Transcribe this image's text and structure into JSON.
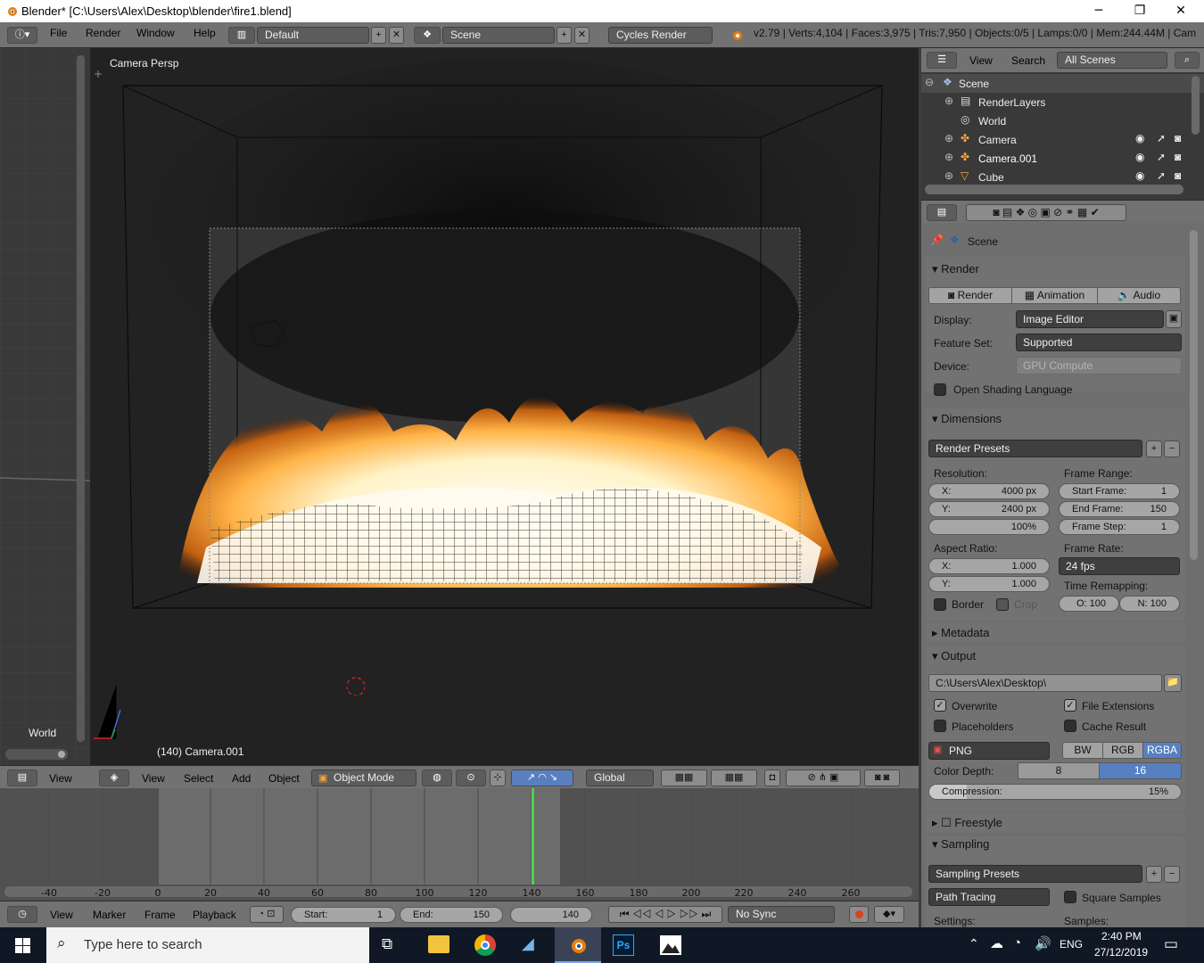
{
  "window": {
    "title": "Blender* [C:\\Users\\Alex\\Desktop\\blender\\fire1.blend]",
    "minimize": "─",
    "maximize": "❐",
    "close": "✕"
  },
  "menubar": {
    "items": [
      "File",
      "Render",
      "Window",
      "Help"
    ],
    "layout": "Default",
    "scene": "Scene",
    "engine": "Cycles Render",
    "stats": "v2.79 | Verts:4,104 | Faces:3,975 | Tris:7,950 | Objects:0/5 | Lamps:0/0 | Mem:244.44M | Cam"
  },
  "viewport": {
    "label": "Camera Persp",
    "status": "(140) Camera.001",
    "world_label": "World"
  },
  "view3d_header": {
    "items": [
      "View",
      "Select",
      "Add",
      "Object"
    ],
    "mode": "Object Mode",
    "orientation": "Global"
  },
  "left_header": {
    "view": "View"
  },
  "timeline": {
    "ticks": [
      "-40",
      "-20",
      "0",
      "20",
      "40",
      "60",
      "80",
      "100",
      "120",
      "140",
      "160",
      "180",
      "200",
      "220",
      "240",
      "260"
    ],
    "current": 140,
    "menu": [
      "View",
      "Marker",
      "Frame",
      "Playback"
    ],
    "start_label": "Start:",
    "start": "1",
    "end_label": "End:",
    "end": "150",
    "frame": "140",
    "sync": "No Sync"
  },
  "outliner": {
    "view": "View",
    "search": "Search",
    "filter": "All Scenes",
    "rows": [
      {
        "name": "Scene"
      },
      {
        "name": "RenderLayers"
      },
      {
        "name": "World"
      },
      {
        "name": "Camera"
      },
      {
        "name": "Camera.001"
      },
      {
        "name": "Cube"
      }
    ]
  },
  "properties": {
    "context": "Scene",
    "render": {
      "title": "Render",
      "buttons": [
        "Render",
        "Animation",
        "Audio"
      ],
      "display_label": "Display:",
      "display": "Image Editor",
      "feature_label": "Feature Set:",
      "feature": "Supported",
      "device_label": "Device:",
      "device": "GPU Compute",
      "osl": "Open Shading Language"
    },
    "dimensions": {
      "title": "Dimensions",
      "presets": "Render Presets",
      "res_label": "Resolution:",
      "x_label": "X:",
      "x": "4000 px",
      "y_label": "Y:",
      "y": "2400 px",
      "pct": "100%",
      "range_label": "Frame Range:",
      "start_label": "Start Frame:",
      "start": "1",
      "end_label": "End Frame:",
      "end": "150",
      "step_label": "Frame Step:",
      "step": "1",
      "aspect_label": "Aspect Ratio:",
      "ax_label": "X:",
      "ax": "1.000",
      "ay_label": "Y:",
      "ay": "1.000",
      "rate_label": "Frame Rate:",
      "rate": "24 fps",
      "remap_label": "Time Remapping:",
      "old": "O: 100",
      "new": "N: 100",
      "border": "Border",
      "crop": "Crop"
    },
    "metadata": {
      "title": "Metadata"
    },
    "output": {
      "title": "Output",
      "path": "C:\\Users\\Alex\\Desktop\\",
      "overwrite": "Overwrite",
      "file_ext": "File Extensions",
      "placeholders": "Placeholders",
      "cache": "Cache Result",
      "format": "PNG",
      "modes": [
        "BW",
        "RGB",
        "RGBA"
      ],
      "depth_label": "Color Depth:",
      "depths": [
        "8",
        "16"
      ],
      "compression_label": "Compression:",
      "compression": "15%"
    },
    "freestyle": {
      "title": "Freestyle"
    },
    "sampling": {
      "title": "Sampling",
      "presets": "Sampling Presets",
      "integrator": "Path Tracing",
      "square": "Square Samples",
      "settings": "Settings:",
      "samples": "Samples:"
    }
  },
  "taskbar": {
    "search": "Type here to search",
    "lang": "ENG",
    "time": "2:40 PM",
    "date": "27/12/2019"
  },
  "colors": {
    "accent": "#5680c2",
    "timeline_cursor": "#4fd14f",
    "flame": "#ff9a2a"
  }
}
